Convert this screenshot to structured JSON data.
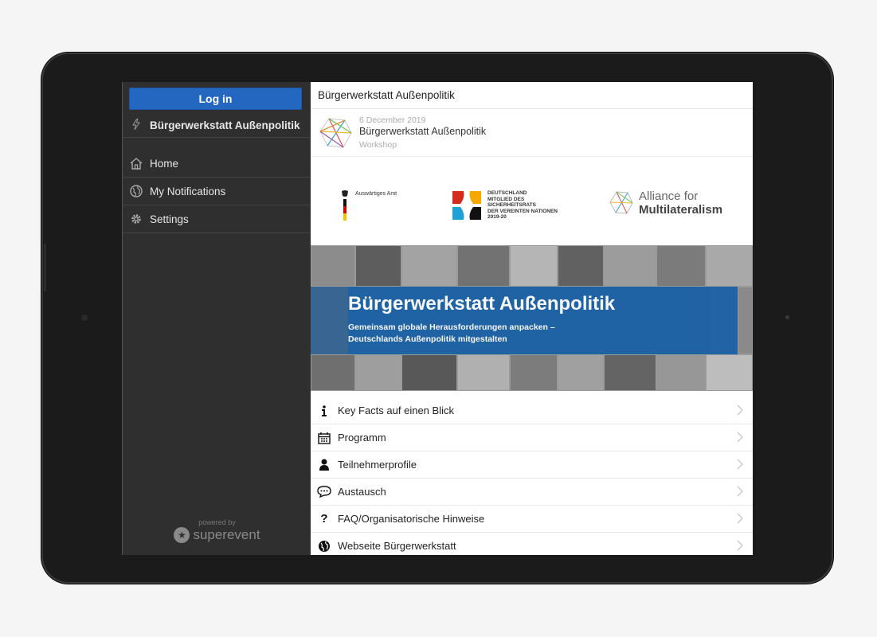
{
  "sidebar": {
    "login_label": "Log in",
    "event_title": "Bürgerwerkstatt Außenpolitik",
    "items": [
      {
        "label": "Home",
        "icon": "home-icon"
      },
      {
        "label": "My Notifications",
        "icon": "globe-icon"
      },
      {
        "label": "Settings",
        "icon": "gear-icon"
      }
    ],
    "powered_by": "powered by",
    "brand": "superevent"
  },
  "main": {
    "title": "Bürgerwerkstatt Außenpolitik",
    "event": {
      "date": "6 December 2019",
      "name": "Bürgerwerkstatt Außenpolitik",
      "type": "Workshop"
    },
    "logos": {
      "auswaertiges_amt": "Auswärtiges Amt",
      "de_line1": "DEUTSCHLAND",
      "de_line2": "MITGLIED DES",
      "de_line3": "SICHERHEITSRATS",
      "de_line4": "DER VEREINTEN NATIONEN",
      "de_line5": "2019-20",
      "alliance_line1": "Alliance for",
      "alliance_line2": "Multilateralism"
    },
    "banner": {
      "headline": "Bürgerwerkstatt Außenpolitik",
      "subline1": "Gemeinsam globale Herausforderungen anpacken –",
      "subline2": "Deutschlands Außenpolitik mitgestalten"
    },
    "menu": [
      {
        "label": "Key Facts auf einen Blick",
        "icon": "info-icon"
      },
      {
        "label": "Programm",
        "icon": "calendar-icon"
      },
      {
        "label": "Teilnehmerprofile",
        "icon": "user-icon"
      },
      {
        "label": "Austausch",
        "icon": "chat-icon"
      },
      {
        "label": "FAQ/Organisatorische Hinweise",
        "icon": "question-icon"
      },
      {
        "label": "Webseite Bürgerwerkstatt",
        "icon": "globe-icon"
      }
    ]
  },
  "colors": {
    "login_blue": "#2467c0",
    "sidebar_bg": "#2f2f2f",
    "banner_blue": "#1d63a8"
  }
}
